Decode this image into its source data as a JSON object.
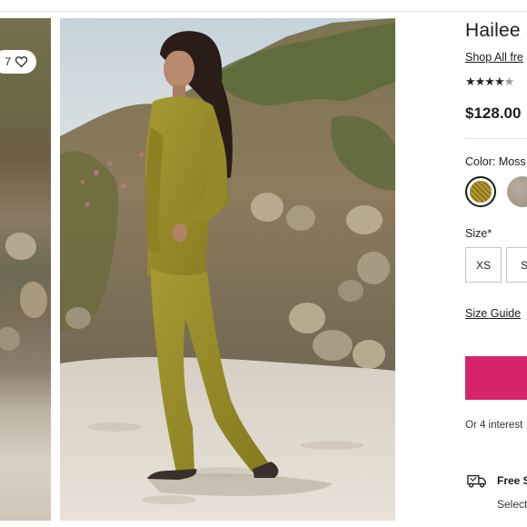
{
  "favorite": {
    "count_text": "7",
    "icon": "heart-outline-icon"
  },
  "product": {
    "title": "Hailee S",
    "shop_link": "Shop All fre",
    "rating_stars": "★★★★",
    "rating_partial": "★",
    "price": "$128.00"
  },
  "color": {
    "label": "Color: Moss",
    "swatches": [
      {
        "name": "Moss",
        "hex": "#a48a24",
        "selected": true
      },
      {
        "name": "Grey",
        "hex": "#a89b8e",
        "selected": false
      }
    ]
  },
  "size": {
    "label": "Size*",
    "options": [
      "XS",
      "S"
    ]
  },
  "size_guide": "Size Guide",
  "add_to_bag": {
    "color": "#d6256d"
  },
  "installments": "Or 4 interest",
  "shipping": {
    "icon": "truck-icon",
    "title": "Free S",
    "subtitle": "Select"
  },
  "brand_colors": {
    "accent_pink": "#d6256d",
    "outfit_moss": "#9b8d2a"
  }
}
